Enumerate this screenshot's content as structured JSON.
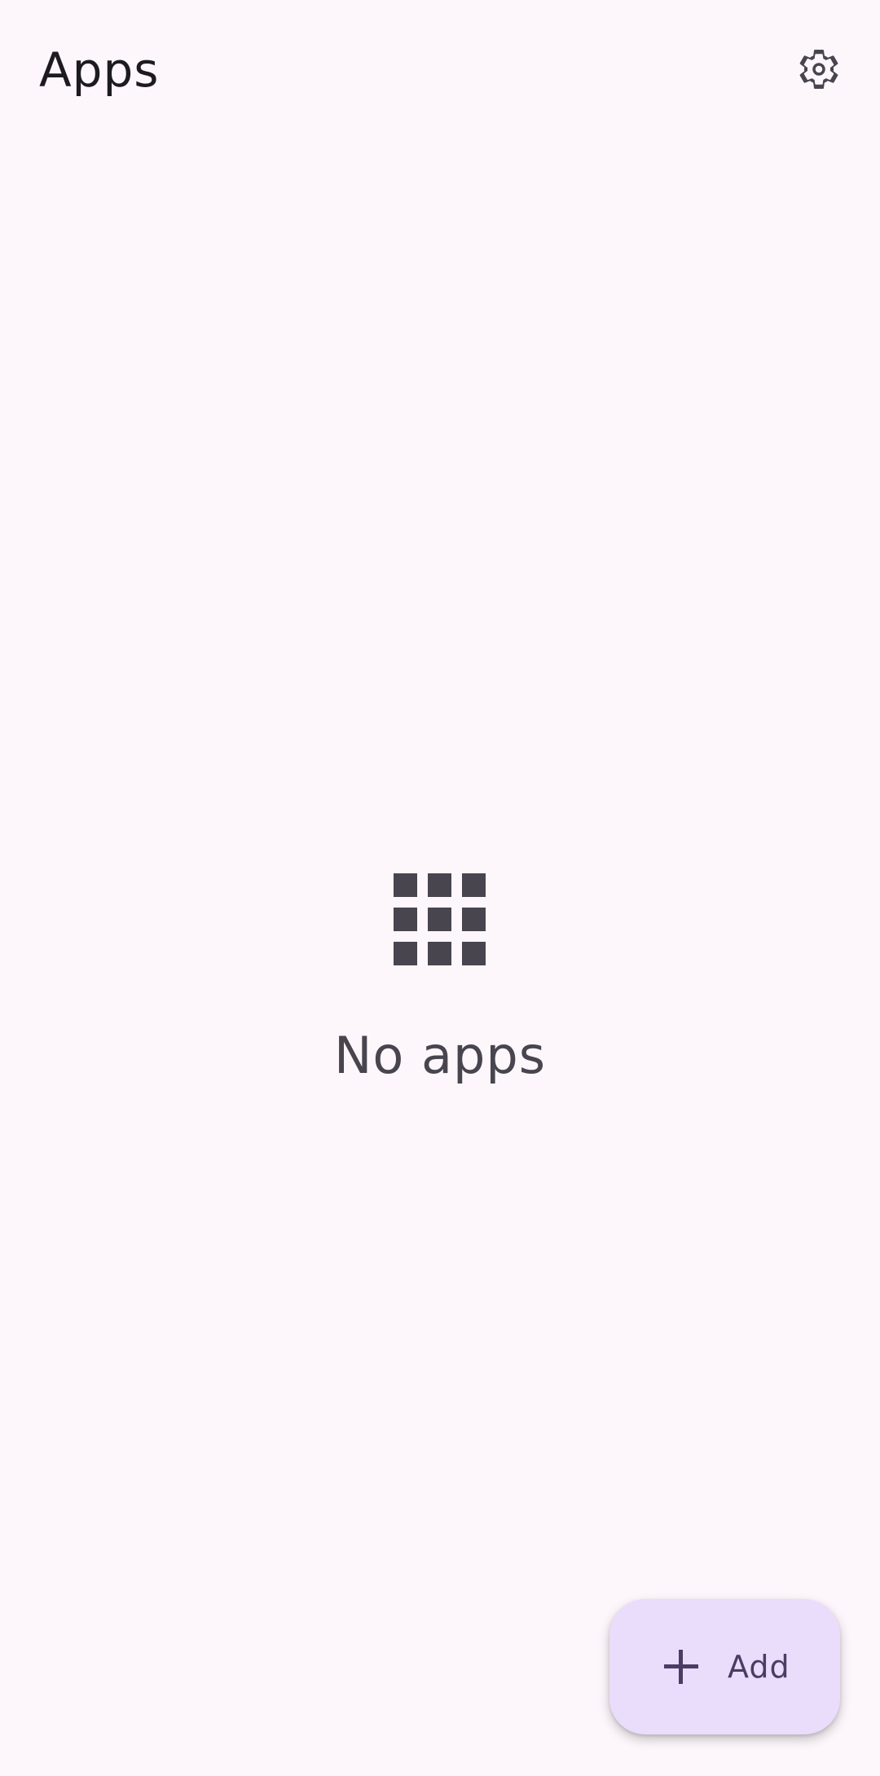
{
  "header": {
    "title": "Apps",
    "settings_icon": "gear-icon"
  },
  "empty_state": {
    "icon": "apps-grid-icon",
    "label": "No apps"
  },
  "fab": {
    "icon": "plus-icon",
    "label": "Add"
  },
  "colors": {
    "background": "#fdf7fc",
    "on_surface": "#1d1b20",
    "on_surface_variant": "#49454f",
    "fab_container": "#eadcfb",
    "fab_content": "#4a3d63"
  }
}
